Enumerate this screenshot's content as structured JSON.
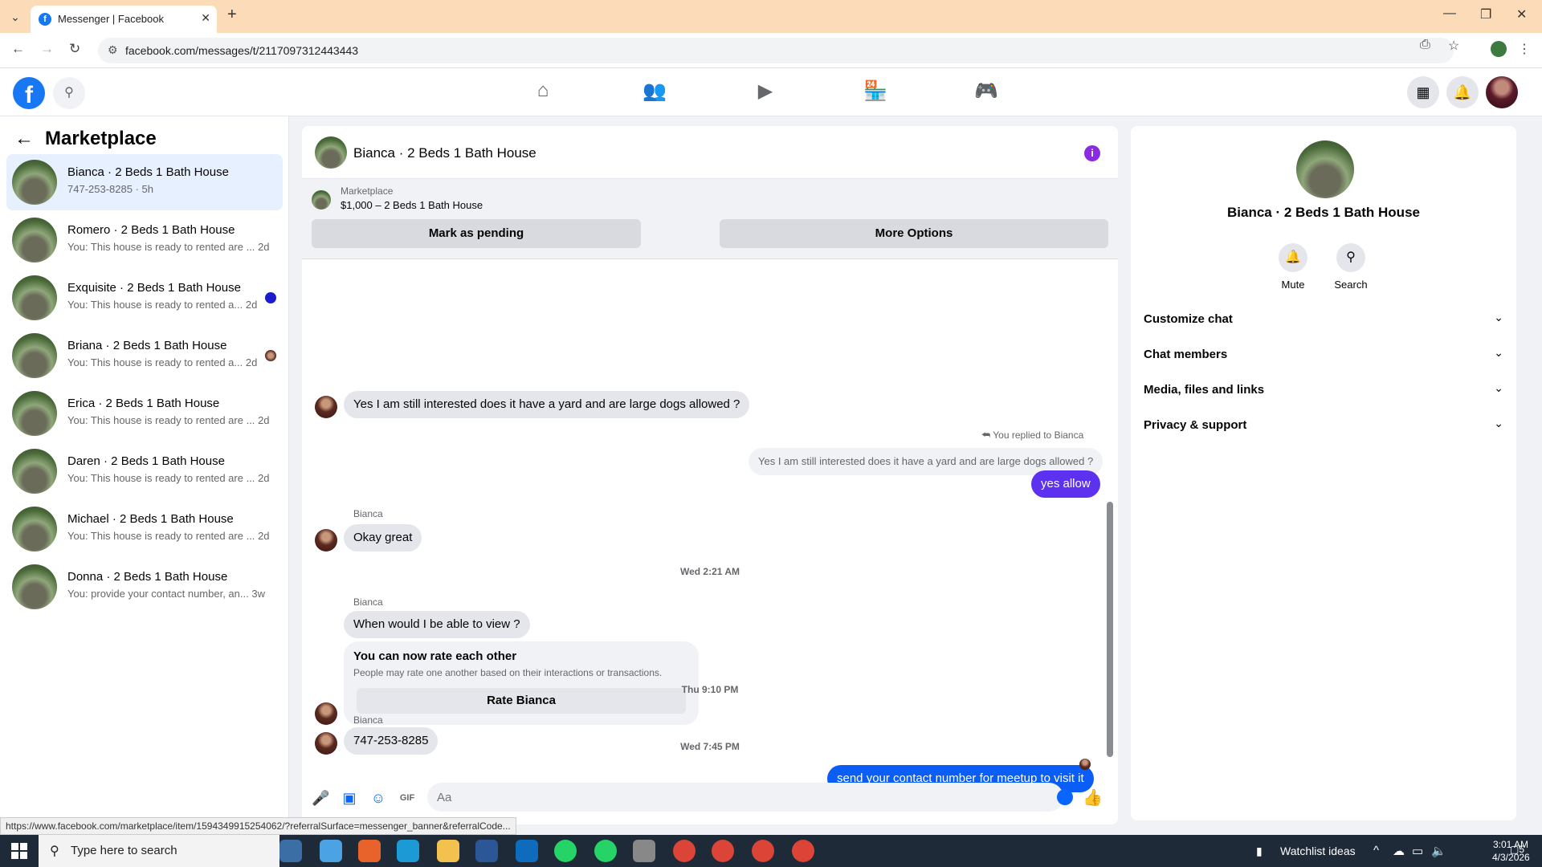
{
  "browser": {
    "tab_title": "Messenger | Facebook",
    "url": "facebook.com/messages/t/2117097312443443",
    "status_url": "https://www.facebook.com/marketplace/item/1594349915254062/?referralSurface=messenger_banner&referralCode..."
  },
  "sidebar": {
    "title": "Marketplace",
    "conversations": [
      {
        "name": "Bianca · 2 Beds 1 Bath House",
        "preview": "747-253-8285 · 5h",
        "active": true
      },
      {
        "name": "Romero · 2 Beds 1 Bath House",
        "preview": "You: This house is ready to rented are ...",
        "time": "2d"
      },
      {
        "name": "Exquisite · 2 Beds 1 Bath House",
        "preview": "You: This house is ready to rented a...",
        "time": "2d"
      },
      {
        "name": "Briana · 2 Beds 1 Bath House",
        "preview": "You: This house is ready to rented a...",
        "time": "2d"
      },
      {
        "name": "Erica · 2 Beds 1 Bath House",
        "preview": "You: This house is ready to rented are ...",
        "time": "2d"
      },
      {
        "name": "Daren · 2 Beds 1 Bath House",
        "preview": "You: This house is ready to rented are ...",
        "time": "2d"
      },
      {
        "name": "Michael · 2 Beds 1 Bath House",
        "preview": "You: This house is ready to rented are ...",
        "time": "2d"
      },
      {
        "name": "Donna · 2 Beds 1 Bath House",
        "preview": "You: provide your contact number, an...",
        "time": "3w"
      }
    ]
  },
  "chat": {
    "title": "Bianca · 2 Beds 1 Bath House",
    "marketplace_label": "Marketplace",
    "listing": "$1,000 – 2 Beds 1 Bath House",
    "mark_pending": "Mark as pending",
    "more_options": "More Options",
    "sender_name": "Bianca",
    "msg1": "Yes I am still interested does it have a yard and are large dogs allowed ?",
    "replied_tag": "You replied to Bianca",
    "quoted": "Yes I am still interested does it have a yard and are large dogs allowed ?",
    "reply_out": "yes allow",
    "msg2": "Okay great",
    "ts1": "Wed 2:21 AM",
    "msg3": "When would I be able to view ?",
    "rate_title": "You can now rate each other",
    "rate_sub": "People may rate one another based on their interactions or transactions.",
    "rate_btn": "Rate Bianca",
    "ts2": "Wed 7:45 PM",
    "out2": "send your contact number for meetup to visit it",
    "ts3": "Thu 9:10 PM",
    "msg4": "747-253-8285",
    "composer_placeholder": "Aa"
  },
  "details": {
    "name": "Bianca · 2 Beds 1 Bath House",
    "mute": "Mute",
    "search": "Search",
    "sections": [
      "Customize chat",
      "Chat members",
      "Media, files and links",
      "Privacy & support"
    ]
  },
  "taskbar": {
    "search_placeholder": "Type here to search",
    "widget": "Watchlist ideas",
    "time": "3:01 AM",
    "date": "4/3/2026",
    "notif_count": "5"
  }
}
